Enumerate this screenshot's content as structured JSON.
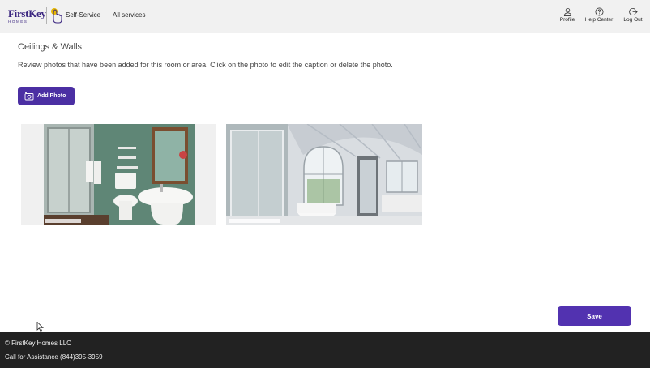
{
  "header": {
    "logo_text": "FirstKey",
    "logo_subtext": "HOMES",
    "self_service_label": "Self-Service",
    "all_services_label": "All services",
    "profile_label": "Profile",
    "help_center_label": "Help Center",
    "logout_label": "Log Out",
    "brand_color": "#3b2680",
    "accent_color": "#e6b800"
  },
  "main": {
    "title": "Ceilings & Walls",
    "instructions": "Review photos that have been added for this room or area. Click on the photo to edit the caption or delete the photo.",
    "add_photo_label": "Add Photo",
    "button_color": "#4b2fa3",
    "photos": [
      {
        "name": "bathroom-photo-1",
        "icon": "bathroom-photo"
      },
      {
        "name": "bathroom-photo-2",
        "icon": "bathroom-photo"
      }
    ],
    "save_label": "Save"
  },
  "footer": {
    "copyright": "© FirstKey Homes LLC",
    "assistance": "Call for Assistance (844)395-3959"
  }
}
